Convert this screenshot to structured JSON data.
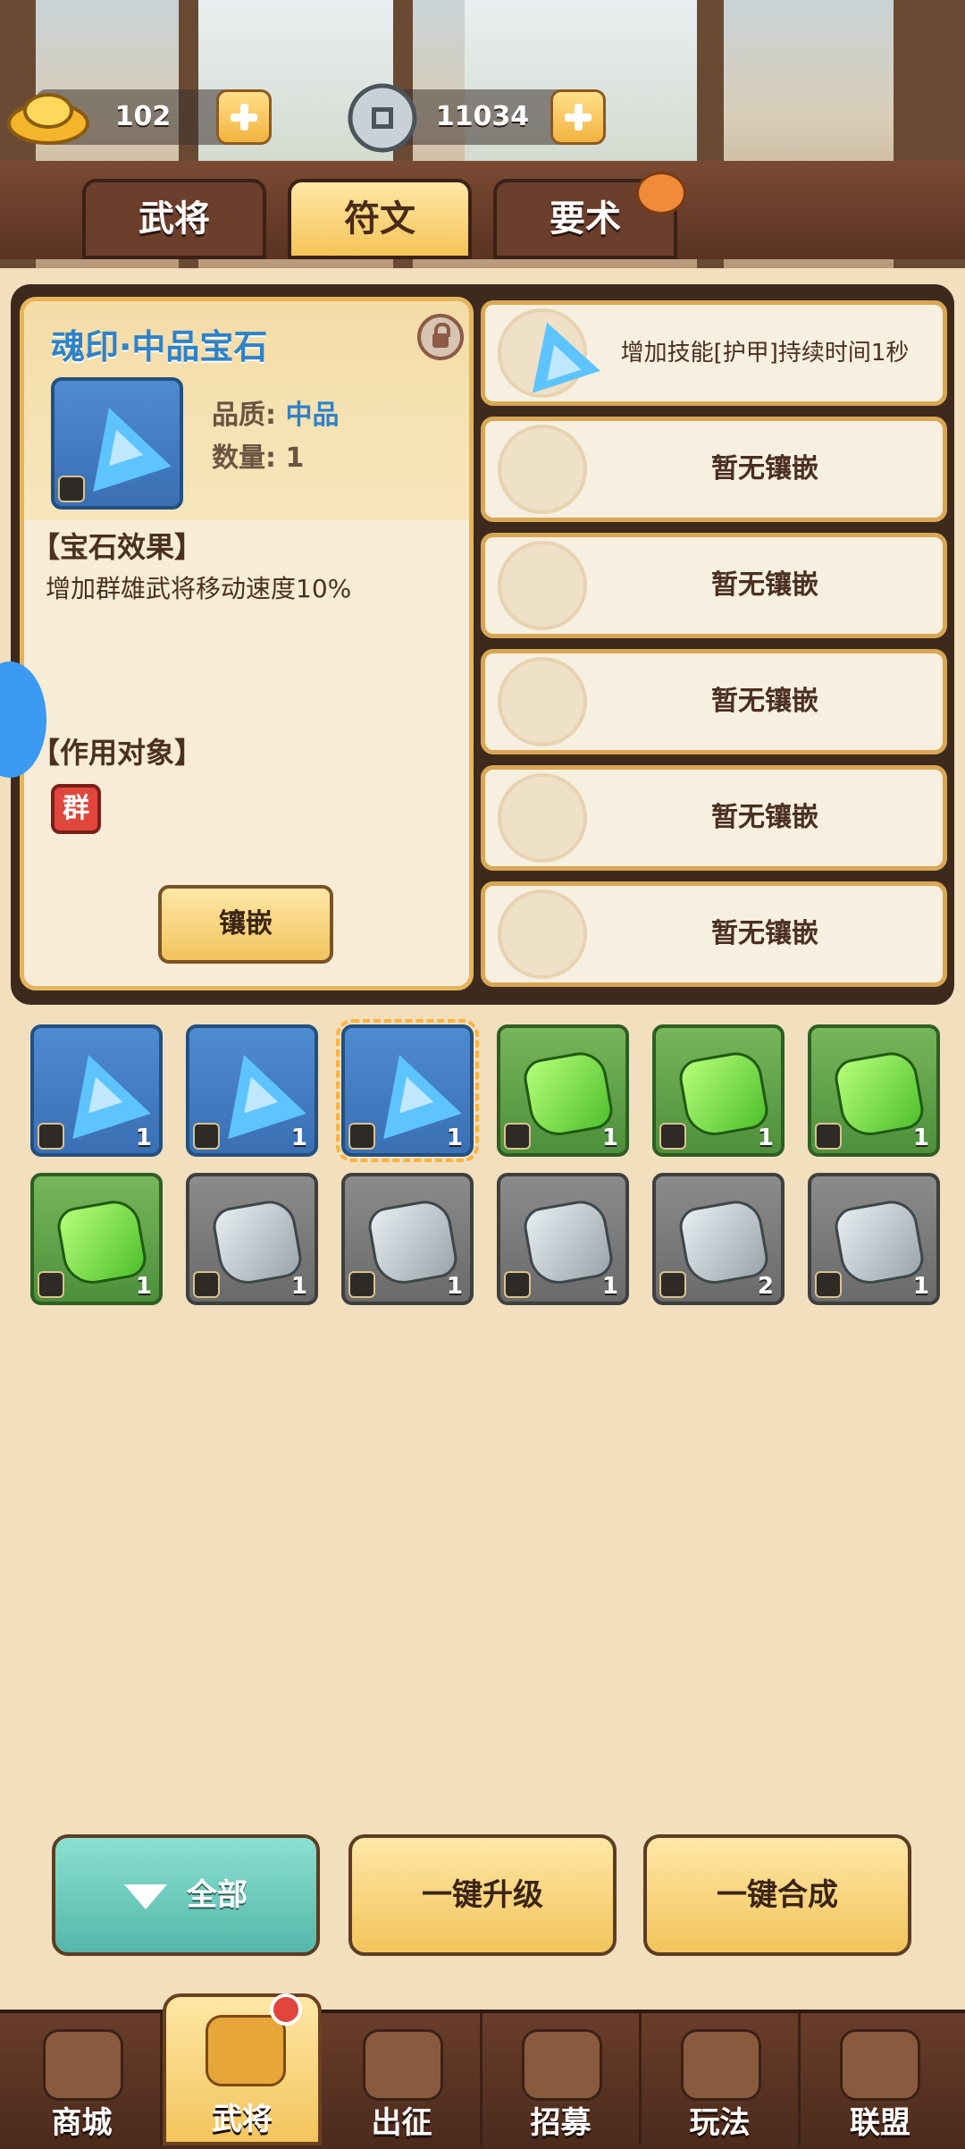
{
  "currency": {
    "gold": "102",
    "silver": "11034"
  },
  "tabs": [
    {
      "label": "武将",
      "active": false
    },
    {
      "label": "符文",
      "active": true
    },
    {
      "label": "要术",
      "active": false
    }
  ],
  "gem_detail": {
    "title": "魂印·中品宝石",
    "quality_label": "品质:",
    "quality_value": "中品",
    "count_label": "数量:",
    "count_value": "1",
    "effect_heading": "【宝石效果】",
    "effect_text": "增加群雄武将移动速度10%",
    "target_heading": "【作用对象】",
    "target_badge": "群",
    "inlay_button": "镶嵌"
  },
  "sockets": [
    {
      "text": "增加技能[护甲]持续时间1秒",
      "filled": true
    },
    {
      "text": "暂无镶嵌",
      "filled": false
    },
    {
      "text": "暂无镶嵌",
      "filled": false
    },
    {
      "text": "暂无镶嵌",
      "filled": false
    },
    {
      "text": "暂无镶嵌",
      "filled": false
    },
    {
      "text": "暂无镶嵌",
      "filled": false
    }
  ],
  "inventory": [
    {
      "type": "blue",
      "count": "1"
    },
    {
      "type": "blue",
      "count": "1"
    },
    {
      "type": "blue",
      "count": "1",
      "selected": true
    },
    {
      "type": "green",
      "count": "1"
    },
    {
      "type": "green",
      "count": "1"
    },
    {
      "type": "green",
      "count": "1"
    },
    {
      "type": "green",
      "count": "1"
    },
    {
      "type": "gray",
      "count": "1"
    },
    {
      "type": "gray",
      "count": "1"
    },
    {
      "type": "gray",
      "count": "1"
    },
    {
      "type": "gray",
      "count": "2"
    },
    {
      "type": "gray",
      "count": "1"
    }
  ],
  "actions": {
    "filter": "全部",
    "upgrade_all": "一键升级",
    "merge_all": "一键合成"
  },
  "bottom_nav": [
    {
      "label": "商城"
    },
    {
      "label": "武将",
      "active": true
    },
    {
      "label": "出征"
    },
    {
      "label": "招募"
    },
    {
      "label": "玩法"
    },
    {
      "label": "联盟"
    }
  ],
  "colors": {
    "accent_gold": "#f2c45c",
    "gem_blue": "#3a6fb3",
    "gem_green": "#4e8f3b",
    "title_blue": "#2f82c8",
    "badge_red": "#e0463c"
  }
}
